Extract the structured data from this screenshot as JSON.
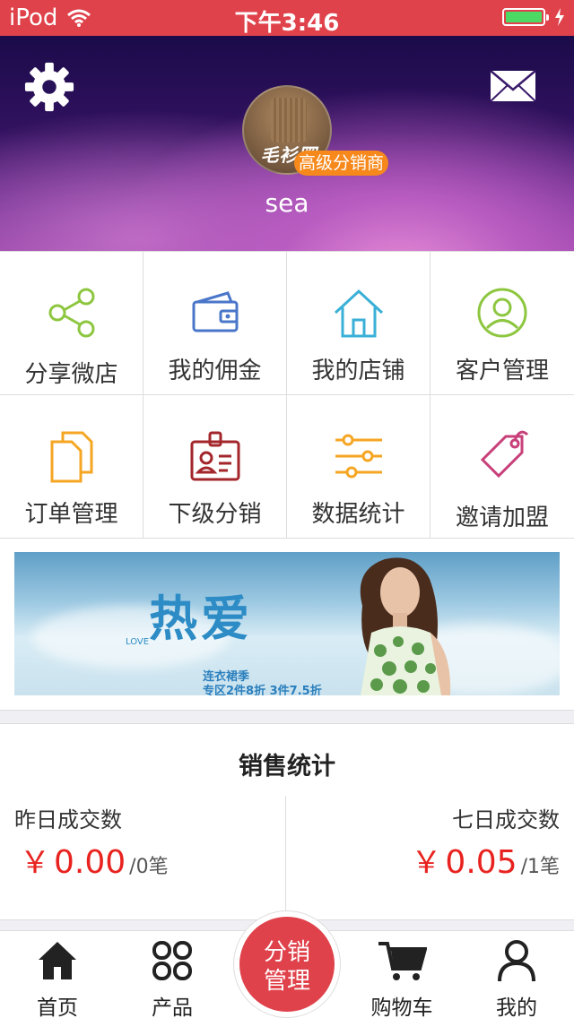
{
  "status_bar": {
    "carrier": "iPod",
    "time": "下午3:46",
    "battery_level": 1.0
  },
  "header": {
    "badge": "高级分销商",
    "username": "sea",
    "avatar_text": "毛衫圈",
    "icons": [
      "gear-icon",
      "mail-icon"
    ]
  },
  "grid": {
    "items": [
      {
        "label": "分享微店",
        "icon": "share-icon",
        "color": "#8dc63f"
      },
      {
        "label": "我的佣金",
        "icon": "wallet-icon",
        "color": "#4a76c9"
      },
      {
        "label": "我的店铺",
        "icon": "house-icon",
        "color": "#3ab0d6"
      },
      {
        "label": "客户管理",
        "icon": "user-circle-icon",
        "color": "#8dc63f"
      },
      {
        "label": "订单管理",
        "icon": "documents-icon",
        "color": "#f5a623"
      },
      {
        "label": "下级分销",
        "icon": "id-badge-icon",
        "color": "#a3262b"
      },
      {
        "label": "数据统计",
        "icon": "sliders-icon",
        "color": "#f5a623"
      },
      {
        "label": "邀请加盟",
        "icon": "tag-icon",
        "color": "#c8407a"
      }
    ]
  },
  "banner": {
    "title": "热爱",
    "love": "LOVE",
    "line1": "连衣裙季",
    "line2": "专区2件8折 3件7.5折"
  },
  "stats": {
    "title": "销售统计",
    "yesterday": {
      "label": "昨日成交数",
      "currency": "￥",
      "amount": "0.00",
      "count": "/0笔"
    },
    "week": {
      "label": "七日成交数",
      "currency": "￥",
      "amount": "0.05",
      "count": "/1笔"
    }
  },
  "tabbar": {
    "home": "首页",
    "products": "产品",
    "center_line1": "分销",
    "center_line2": "管理",
    "cart": "购物车",
    "mine": "我的",
    "icons": [
      "home-icon",
      "grid-icon",
      "cart-icon",
      "person-icon"
    ]
  },
  "colors": {
    "brand_red": "#e0424b",
    "price_red": "#e8231f",
    "badge_orange": "#f7891c"
  }
}
